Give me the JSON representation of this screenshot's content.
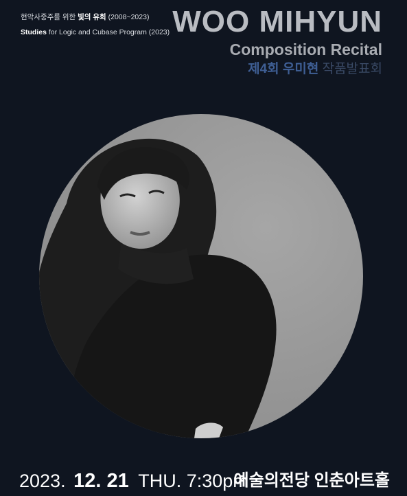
{
  "programs": {
    "line1": {
      "prefix": "현악사중주를 위한",
      "title": "빛의 유희",
      "years": "(2008~2023)"
    },
    "line2": {
      "title": "Studies",
      "rest": "for Logic and Cubase Program (2023)"
    }
  },
  "header": {
    "name": "WOO MIHYUN",
    "subtitle": "Composition Recital",
    "korean_strong": "제4회 우미현",
    "korean_light": "작품발표회"
  },
  "photo": {
    "subject": "portrait-photo"
  },
  "footer": {
    "year": "2023.",
    "month_day": "12. 21",
    "weekday_time": "THU. 7:30pm",
    "venue": "예술의전당 인춘아트홀"
  },
  "colors": {
    "background": "#0f1520",
    "title_gray": "#b9bcc2",
    "korean_blue": "#3f5f95",
    "circle_gray": "#9d9d9d"
  }
}
